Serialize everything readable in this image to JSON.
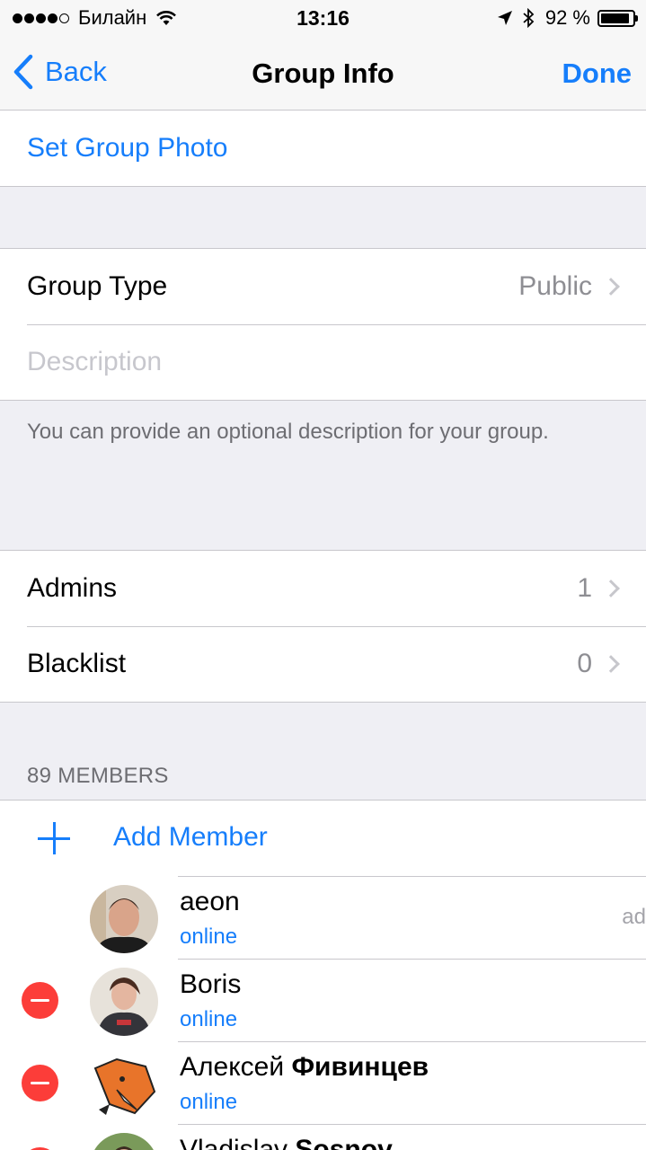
{
  "status_bar": {
    "carrier": "Билайн",
    "time": "13:16",
    "battery_text": "92 %",
    "battery_level": 0.92,
    "icons": [
      "signal-dots-icon",
      "wifi-icon",
      "location-icon",
      "bluetooth-icon",
      "battery-icon"
    ]
  },
  "nav": {
    "back_label": "Back",
    "title": "Group Info",
    "done_label": "Done"
  },
  "photo_section": {
    "set_photo_label": "Set Group Photo"
  },
  "info_section": {
    "group_type_label": "Group Type",
    "group_type_value": "Public",
    "description_placeholder": "Description",
    "description_hint": "You can provide an optional description for your group."
  },
  "admin_section": {
    "admins_label": "Admins",
    "admins_count": "1",
    "blacklist_label": "Blacklist",
    "blacklist_count": "0"
  },
  "members": {
    "header": "89 MEMBERS",
    "add_label": "Add Member",
    "list": [
      {
        "first": "aeon",
        "last": "",
        "status": "online",
        "role": "ad"
      },
      {
        "first": "Boris",
        "last": "",
        "status": "online"
      },
      {
        "first": "Алексей",
        "last": "Фивинцев",
        "status": "online"
      },
      {
        "first": "Vladislav",
        "last": "Sosnov",
        "status": ""
      }
    ]
  },
  "colors": {
    "accent": "#167efb",
    "destructive": "#fc3d39",
    "background": "#efeff4"
  }
}
